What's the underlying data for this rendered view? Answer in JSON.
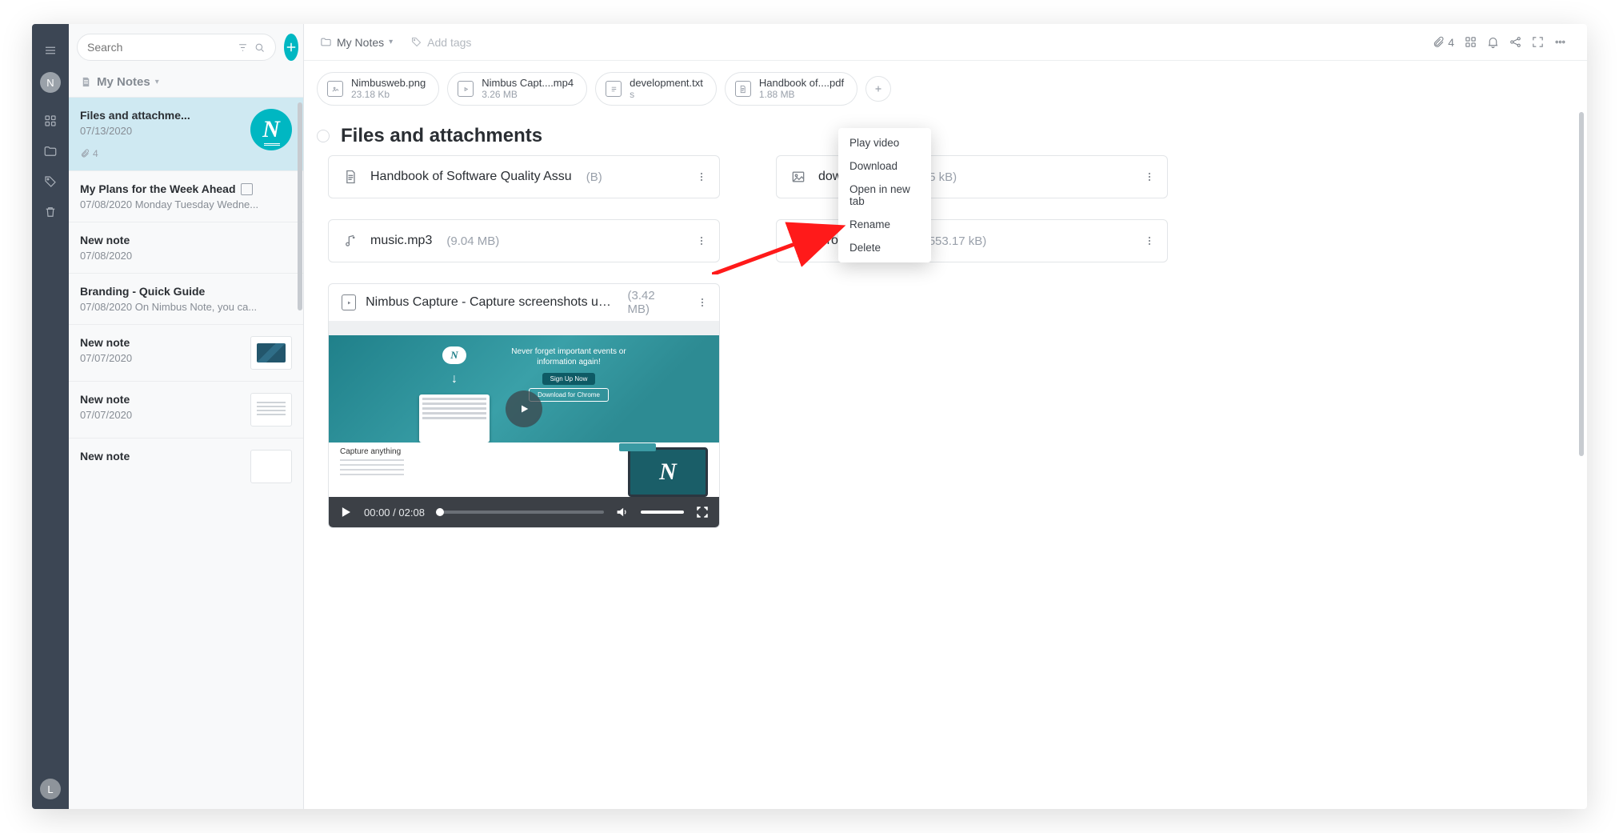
{
  "rail": {
    "top_avatar": "N",
    "bottom_avatar": "L"
  },
  "search": {
    "placeholder": "Search"
  },
  "folder_header": "My Notes",
  "notes": [
    {
      "title": "Files and attachme...",
      "date": "07/13/2020",
      "attach_count": "4"
    },
    {
      "title": "My Plans for the Week Ahead",
      "date": "07/08/2020",
      "snippet": "Monday Tuesday Wedne..."
    },
    {
      "title": "New note",
      "date": "07/08/2020"
    },
    {
      "title": "Branding - Quick Guide",
      "date": "07/08/2020",
      "snippet": "On Nimbus Note, you ca..."
    },
    {
      "title": "New note",
      "date": "07/07/2020"
    },
    {
      "title": "New note",
      "date": "07/07/2020"
    },
    {
      "title": "New note",
      "date": ""
    }
  ],
  "breadcrumb": "My Notes",
  "add_tags": "Add tags",
  "header_attach_count": "4",
  "chips": [
    {
      "name": "Nimbusweb.png",
      "size": "23.18 Kb",
      "icon": "image"
    },
    {
      "name": "Nimbus Capt....mp4",
      "size": "3.26 MB",
      "icon": "video"
    },
    {
      "name": "development.txt",
      "size": "s",
      "icon": "text"
    },
    {
      "name": "Handbook of....pdf",
      "size": "1.88 MB",
      "icon": "doc"
    }
  ],
  "page_title": "Files and attachments",
  "files": [
    {
      "name": "Handbook of Software Quality Assu",
      "size": "(B)",
      "icon": "doc"
    },
    {
      "name": "download.jpg",
      "size": "(6.25 kB)",
      "icon": "image"
    },
    {
      "name": "music.mp3",
      "size": "(9.04 MB)",
      "icon": "music"
    },
    {
      "name": "Product Wiki.zip",
      "size": "(553.17 kB)",
      "icon": "zip"
    }
  ],
  "video": {
    "name": "Nimbus Capture - Capture screenshots us... mp4",
    "size": "(3.42 MB)",
    "current": "00:00",
    "total": "02:08",
    "hero_line": "Never forget important events or information again!",
    "btn1": "Sign Up Now",
    "btn2": "Download for Chrome",
    "caption": "Capture anything"
  },
  "context_menu": [
    "Play video",
    "Download",
    "Open in new tab",
    "Rename",
    "Delete"
  ]
}
